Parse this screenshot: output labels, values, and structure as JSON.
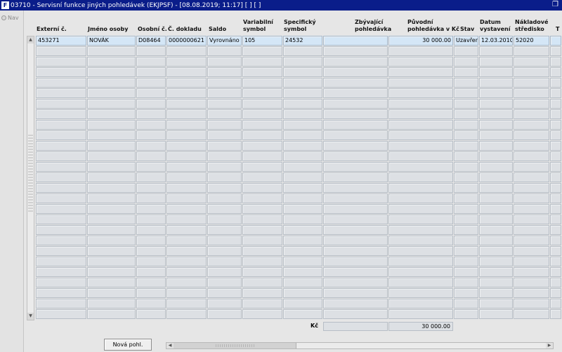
{
  "window": {
    "title": "03710 - Servisní funkce jiných pohledávek (EKJPSF) - [08.08.2019; 11:17]  [ ]  [ ]",
    "app_icon": "F"
  },
  "nav": {
    "label": "Nav"
  },
  "columns": [
    {
      "key": "externi",
      "label": "Externí č."
    },
    {
      "key": "jmeno",
      "label": "Jméno osoby"
    },
    {
      "key": "osobni",
      "label": "Osobní č."
    },
    {
      "key": "doklad",
      "label": "Č. dokladu"
    },
    {
      "key": "saldo",
      "label": "Saldo"
    },
    {
      "key": "vs",
      "label": "Variabilní\nsymbol"
    },
    {
      "key": "ss",
      "label": "Specifický\nsymbol"
    },
    {
      "key": "zbyva",
      "label": "Zbývající\npohledávka"
    },
    {
      "key": "puvodni",
      "label": "Původní\npohledávka v Kč"
    },
    {
      "key": "stav",
      "label": "Stav"
    },
    {
      "key": "datum",
      "label": "Datum\nvystavení"
    },
    {
      "key": "nakl",
      "label": "Nákladové\nstředisko"
    },
    {
      "key": "extra",
      "label": "T"
    }
  ],
  "rows": [
    {
      "externi": "453271",
      "jmeno": "NOVÁK",
      "osobni": "D08464",
      "doklad": "0000000621",
      "saldo": "Vyrovnáno",
      "vs": "105",
      "ss": "24532",
      "zbyva": "",
      "puvodni": "30 000.00",
      "stav": "Uzavřen",
      "datum": "12.03.2010",
      "nakl": "52020",
      "extra": ""
    }
  ],
  "visible_row_count": 27,
  "totals": {
    "label": "Kč",
    "zbyva": "",
    "puvodni": "30 000.00"
  },
  "buttons": {
    "new_label": "Nová pohl."
  },
  "colors": {
    "titlebar": "#0a1d8a",
    "selected_row": "#d4e6f6",
    "focus_border": "#e02020"
  }
}
